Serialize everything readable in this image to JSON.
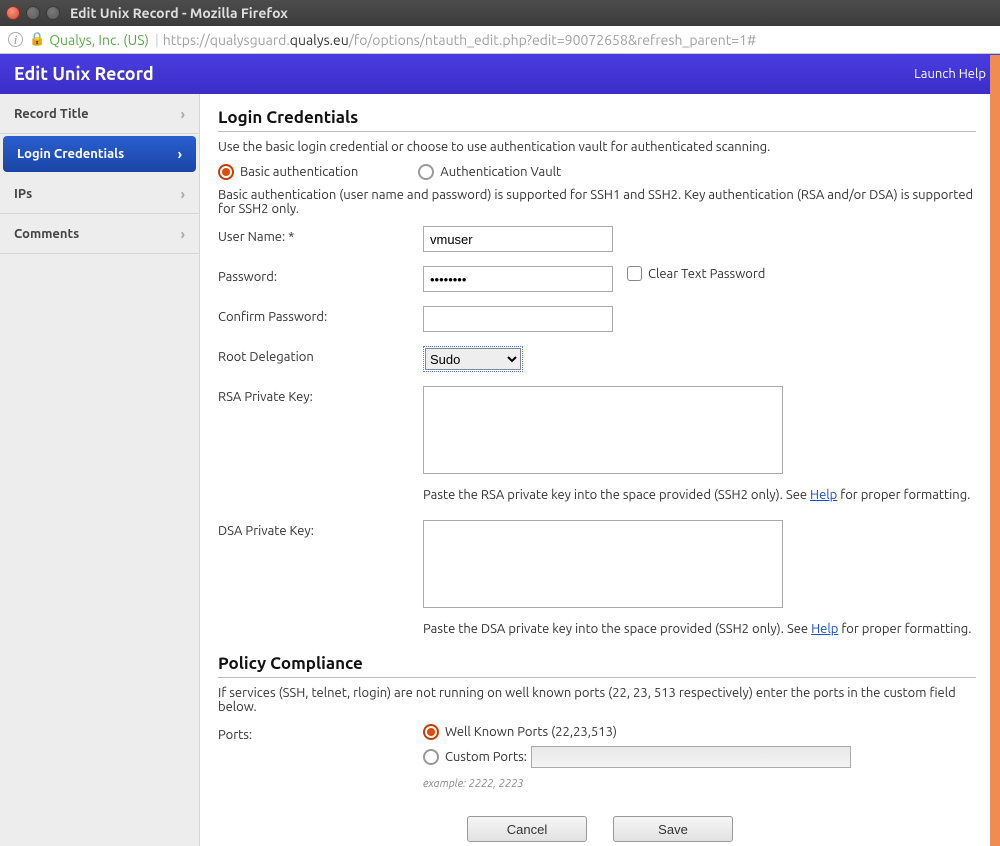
{
  "window": {
    "title": "Edit Unix Record - Mozilla Firefox"
  },
  "url": {
    "org": "Qualys, Inc. (US)",
    "proto": "https://",
    "sub": "qualysguard.",
    "domain": "qualys.eu",
    "path": "/fo/options/ntauth_edit.php?edit=90072658&refresh_parent=1#"
  },
  "header": {
    "title": "Edit Unix Record",
    "help": "Launch Help"
  },
  "sidebar": {
    "items": [
      {
        "label": "Record Title"
      },
      {
        "label": "Login Credentials"
      },
      {
        "label": "IPs"
      },
      {
        "label": "Comments"
      }
    ]
  },
  "login": {
    "section_title": "Login Credentials",
    "intro": "Use the basic login credential or choose to use authentication vault for authenticated scanning.",
    "radio_basic": "Basic authentication",
    "radio_vault": "Authentication Vault",
    "basic_note": "Basic authentication (user name and password) is supported for SSH1 and SSH2. Key authentication (RSA and/or DSA) is supported for SSH2 only.",
    "labels": {
      "username": "User Name: *",
      "password": "Password:",
      "confirm": "Confirm Password:",
      "root": "Root Delegation",
      "rsa": "RSA Private Key:",
      "dsa": "DSA Private Key:"
    },
    "values": {
      "username": "vmuser",
      "password": "••••••••",
      "confirm": "",
      "root_selected": "Sudo"
    },
    "cleartext": "Clear Text Password",
    "rsa_help_pre": "Paste the RSA private key into the space provided (SSH2 only). See ",
    "rsa_help_post": " for proper formatting.",
    "dsa_help_pre": "Paste the DSA private key into the space provided (SSH2 only). See ",
    "dsa_help_post": " for proper formatting.",
    "help_link": "Help"
  },
  "policy": {
    "section_title": "Policy Compliance",
    "intro": "If services (SSH, telnet, rlogin) are not running on well known ports (22, 23, 513 respectively) enter the ports in the custom field below.",
    "ports_label": "Ports:",
    "well_known": "Well Known Ports (22,23,513)",
    "custom": "Custom Ports:",
    "example": "example: 2222, 2223"
  },
  "footer": {
    "cancel": "Cancel",
    "save": "Save"
  }
}
